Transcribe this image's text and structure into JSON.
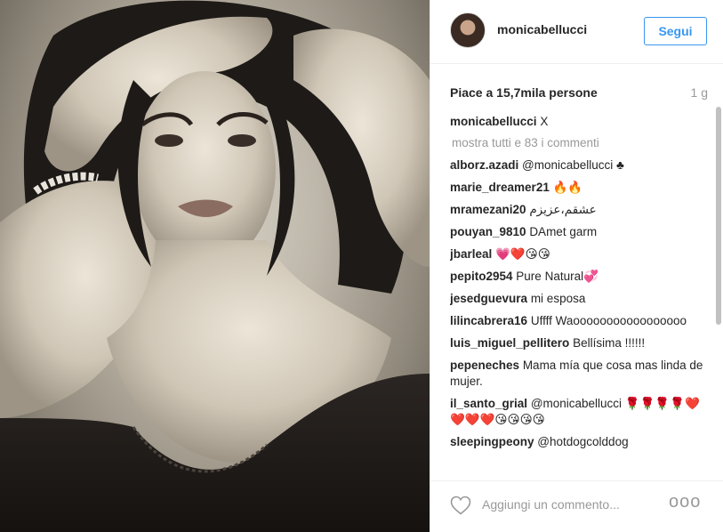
{
  "post": {
    "username": "monicabellucci",
    "follow_label": "Segui",
    "likes": "Piace a 15,7mila persone",
    "timestamp": "1 g",
    "caption": {
      "user": "monicabellucci",
      "text": "X"
    },
    "show_all": "mostra tutti e 83 i commenti",
    "comments": [
      {
        "user": "alborz.azadi",
        "text": "@monicabellucci ♣"
      },
      {
        "user": "marie_dreamer21",
        "text": "🔥🔥"
      },
      {
        "user": "mramezani20",
        "text": "عشقم،عزیزم"
      },
      {
        "user": "pouyan_9810",
        "text": "DAmet garm"
      },
      {
        "user": "jbarleal",
        "text": "💗❤️😘😘"
      },
      {
        "user": "pepito2954",
        "text": "Pure Natural💞"
      },
      {
        "user": "jesedguevura",
        "text": "mi esposa"
      },
      {
        "user": "lilincabrera16",
        "text": "Uffff Waooooooooooooooooo"
      },
      {
        "user": "luis_miguel_pellitero",
        "text": "Bellísima !!!!!!"
      },
      {
        "user": "pepeneches",
        "text": "Mama mía que cosa mas linda de mujer."
      },
      {
        "user": "il_santo_grial",
        "text": "@monicabellucci 🌹🌹🌹🌹❤️❤️❤️❤️😘😘😘😘"
      },
      {
        "user": "sleepingpeony",
        "text": "@hotdogcolddog"
      }
    ],
    "comment_placeholder": "Aggiungi un commento...",
    "more_label": "ooo"
  },
  "icons": {
    "like": "heart-icon",
    "more": "more-options-icon"
  },
  "colors": {
    "accent": "#3897f0",
    "muted": "#999999",
    "text": "#262626",
    "border": "#efefef"
  }
}
